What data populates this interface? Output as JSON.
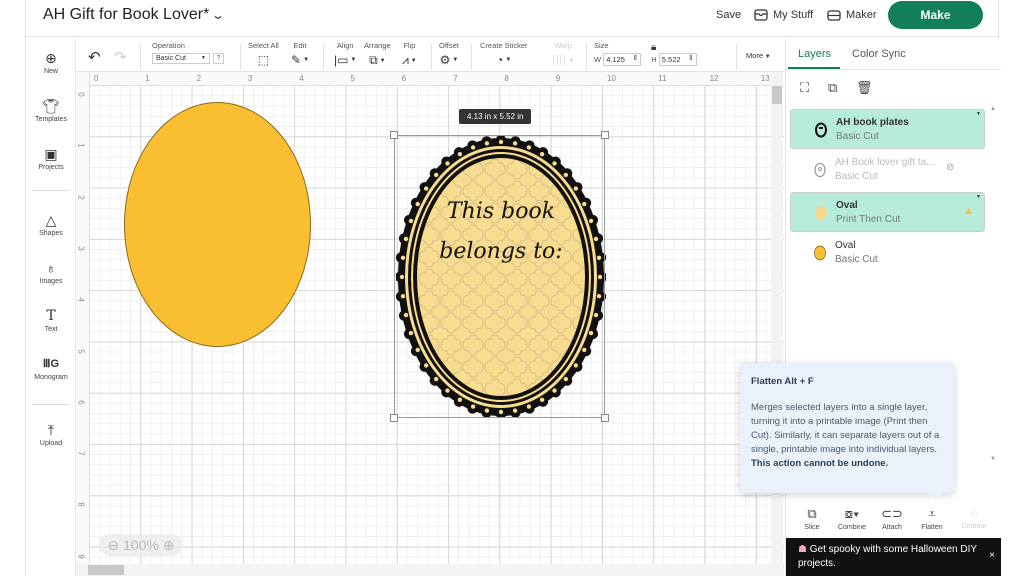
{
  "header": {
    "title": "AH Gift for Book Lover*",
    "save_label": "Save",
    "my_stuff_label": "My Stuff",
    "maker_label": "Maker",
    "make_label": "Make",
    "accent_color": "#127f57"
  },
  "toolbar": {
    "operation_label": "Operation",
    "operation_value": "Basic Cut",
    "help_label": "?",
    "select_all_label": "Select All",
    "edit_label": "Edit",
    "align_label": "Align",
    "arrange_label": "Arrange",
    "flip_label": "Flip",
    "offset_label": "Offset",
    "create_sticker_label": "Create Sticker",
    "warp_label": "Warp",
    "size_label": "Size",
    "width_label": "W",
    "width_value": "4.125",
    "height_label": "H",
    "height_value": "5.522",
    "more_label": "More"
  },
  "sidebar": {
    "items": [
      {
        "label": "New",
        "icon": "plus-circle-icon"
      },
      {
        "label": "Templates",
        "icon": "shirt-icon"
      },
      {
        "label": "Projects",
        "icon": "projects-icon"
      },
      {
        "label": "Shapes",
        "icon": "shapes-icon"
      },
      {
        "label": "Images",
        "icon": "lightbulb-icon"
      },
      {
        "label": "Text",
        "icon": "text-icon"
      },
      {
        "label": "Monogram",
        "icon": "monogram-icon"
      },
      {
        "label": "Upload",
        "icon": "upload-icon"
      }
    ]
  },
  "canvas": {
    "ruler_top": [
      "0",
      "1",
      "2",
      "3",
      "4",
      "5",
      "6",
      "7",
      "8",
      "9",
      "10",
      "11",
      "12",
      "13"
    ],
    "ruler_left": [
      "0",
      "1",
      "2",
      "3",
      "4",
      "5",
      "6",
      "7",
      "8",
      "9"
    ],
    "dimension_tooltip": "4.13  in x 5.52  in",
    "plate_text_line1": "This book",
    "plate_text_line2": "belongs to:",
    "zoom_level": "100%",
    "oval_color": "#f9be31",
    "plate_fill_color": "#f8dc8f"
  },
  "panel": {
    "tabs": [
      "Layers",
      "Color Sync"
    ],
    "layers": [
      {
        "name": "AH book plates",
        "type": "Basic Cut",
        "selected": true,
        "hidden": false
      },
      {
        "name": "AH Book lover gift ta...",
        "type": "Basic Cut",
        "selected": false,
        "hidden": true
      },
      {
        "name": "Oval",
        "type": "Print Then Cut",
        "selected": true,
        "hidden": false,
        "warning": true
      },
      {
        "name": "Oval",
        "type": "Basic Cut",
        "selected": false,
        "hidden": false
      }
    ],
    "bottom_tools": [
      {
        "label": "Slice",
        "icon": "slice-icon",
        "enabled": true
      },
      {
        "label": "Combine",
        "icon": "combine-icon",
        "enabled": true
      },
      {
        "label": "Attach",
        "icon": "attach-icon",
        "enabled": true
      },
      {
        "label": "Flatten",
        "icon": "flatten-icon",
        "enabled": true
      },
      {
        "label": "Contour",
        "icon": "contour-icon",
        "enabled": false
      }
    ],
    "toast_text": "Get spooky with some Halloween DIY projects.",
    "toast_close": "×"
  },
  "tooltip": {
    "title": "Flatten Alt + F",
    "body": "Merges selected layers into a single layer, turning it into a printable image (Print then Cut). Similarly, it can separate layers out of a single, printable image into individual layers. ",
    "bold": "This action cannot be undone."
  }
}
